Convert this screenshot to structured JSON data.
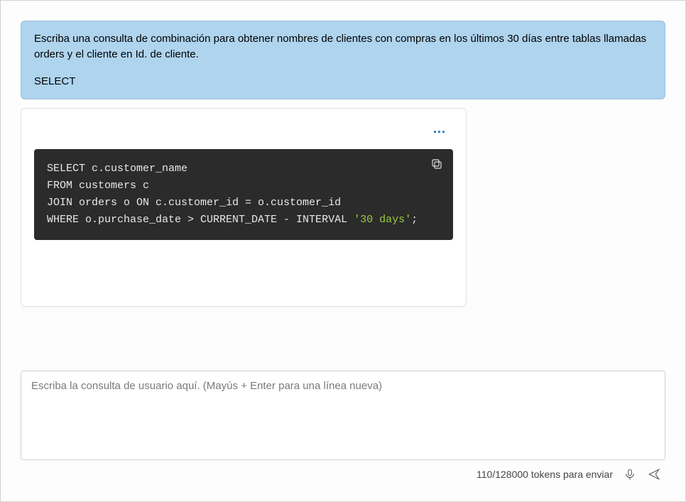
{
  "user_prompt_line1": "Escriba una consulta de combinación para obtener nombres de clientes con compras en los últimos 30 días entre tablas llamadas orders y el cliente en Id. de cliente.",
  "user_prompt_line2": "SELECT",
  "more_button": "...",
  "code": {
    "line1": "SELECT c.customer_name",
    "line2": "FROM customers c",
    "line3": "JOIN orders o ON c.customer_id = o.customer_id",
    "line4_prefix": "WHERE o.purchase_date > CURRENT_DATE - INTERVAL ",
    "line4_literal": "'30 days'",
    "line4_suffix": ";"
  },
  "input": {
    "placeholder": "Escriba la consulta de usuario aquí. (Mayús + Enter para una línea nueva)",
    "value": ""
  },
  "footer": {
    "token_status": "110/128000 tokens para enviar"
  },
  "icons": {
    "copy": "copy-icon",
    "mic": "mic-icon",
    "send": "send-icon"
  }
}
